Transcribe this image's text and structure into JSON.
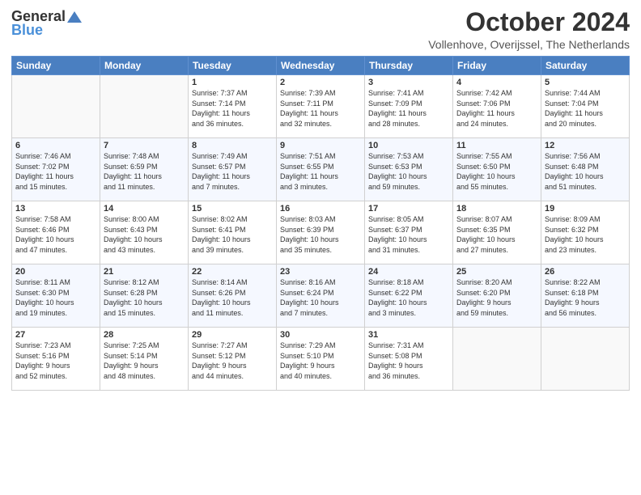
{
  "logo": {
    "general": "General",
    "blue": "Blue"
  },
  "title": "October 2024",
  "location": "Vollenhove, Overijssel, The Netherlands",
  "days_header": [
    "Sunday",
    "Monday",
    "Tuesday",
    "Wednesday",
    "Thursday",
    "Friday",
    "Saturday"
  ],
  "weeks": [
    [
      {
        "day": "",
        "info": ""
      },
      {
        "day": "",
        "info": ""
      },
      {
        "day": "1",
        "info": "Sunrise: 7:37 AM\nSunset: 7:14 PM\nDaylight: 11 hours\nand 36 minutes."
      },
      {
        "day": "2",
        "info": "Sunrise: 7:39 AM\nSunset: 7:11 PM\nDaylight: 11 hours\nand 32 minutes."
      },
      {
        "day": "3",
        "info": "Sunrise: 7:41 AM\nSunset: 7:09 PM\nDaylight: 11 hours\nand 28 minutes."
      },
      {
        "day": "4",
        "info": "Sunrise: 7:42 AM\nSunset: 7:06 PM\nDaylight: 11 hours\nand 24 minutes."
      },
      {
        "day": "5",
        "info": "Sunrise: 7:44 AM\nSunset: 7:04 PM\nDaylight: 11 hours\nand 20 minutes."
      }
    ],
    [
      {
        "day": "6",
        "info": "Sunrise: 7:46 AM\nSunset: 7:02 PM\nDaylight: 11 hours\nand 15 minutes."
      },
      {
        "day": "7",
        "info": "Sunrise: 7:48 AM\nSunset: 6:59 PM\nDaylight: 11 hours\nand 11 minutes."
      },
      {
        "day": "8",
        "info": "Sunrise: 7:49 AM\nSunset: 6:57 PM\nDaylight: 11 hours\nand 7 minutes."
      },
      {
        "day": "9",
        "info": "Sunrise: 7:51 AM\nSunset: 6:55 PM\nDaylight: 11 hours\nand 3 minutes."
      },
      {
        "day": "10",
        "info": "Sunrise: 7:53 AM\nSunset: 6:53 PM\nDaylight: 10 hours\nand 59 minutes."
      },
      {
        "day": "11",
        "info": "Sunrise: 7:55 AM\nSunset: 6:50 PM\nDaylight: 10 hours\nand 55 minutes."
      },
      {
        "day": "12",
        "info": "Sunrise: 7:56 AM\nSunset: 6:48 PM\nDaylight: 10 hours\nand 51 minutes."
      }
    ],
    [
      {
        "day": "13",
        "info": "Sunrise: 7:58 AM\nSunset: 6:46 PM\nDaylight: 10 hours\nand 47 minutes."
      },
      {
        "day": "14",
        "info": "Sunrise: 8:00 AM\nSunset: 6:43 PM\nDaylight: 10 hours\nand 43 minutes."
      },
      {
        "day": "15",
        "info": "Sunrise: 8:02 AM\nSunset: 6:41 PM\nDaylight: 10 hours\nand 39 minutes."
      },
      {
        "day": "16",
        "info": "Sunrise: 8:03 AM\nSunset: 6:39 PM\nDaylight: 10 hours\nand 35 minutes."
      },
      {
        "day": "17",
        "info": "Sunrise: 8:05 AM\nSunset: 6:37 PM\nDaylight: 10 hours\nand 31 minutes."
      },
      {
        "day": "18",
        "info": "Sunrise: 8:07 AM\nSunset: 6:35 PM\nDaylight: 10 hours\nand 27 minutes."
      },
      {
        "day": "19",
        "info": "Sunrise: 8:09 AM\nSunset: 6:32 PM\nDaylight: 10 hours\nand 23 minutes."
      }
    ],
    [
      {
        "day": "20",
        "info": "Sunrise: 8:11 AM\nSunset: 6:30 PM\nDaylight: 10 hours\nand 19 minutes."
      },
      {
        "day": "21",
        "info": "Sunrise: 8:12 AM\nSunset: 6:28 PM\nDaylight: 10 hours\nand 15 minutes."
      },
      {
        "day": "22",
        "info": "Sunrise: 8:14 AM\nSunset: 6:26 PM\nDaylight: 10 hours\nand 11 minutes."
      },
      {
        "day": "23",
        "info": "Sunrise: 8:16 AM\nSunset: 6:24 PM\nDaylight: 10 hours\nand 7 minutes."
      },
      {
        "day": "24",
        "info": "Sunrise: 8:18 AM\nSunset: 6:22 PM\nDaylight: 10 hours\nand 3 minutes."
      },
      {
        "day": "25",
        "info": "Sunrise: 8:20 AM\nSunset: 6:20 PM\nDaylight: 9 hours\nand 59 minutes."
      },
      {
        "day": "26",
        "info": "Sunrise: 8:22 AM\nSunset: 6:18 PM\nDaylight: 9 hours\nand 56 minutes."
      }
    ],
    [
      {
        "day": "27",
        "info": "Sunrise: 7:23 AM\nSunset: 5:16 PM\nDaylight: 9 hours\nand 52 minutes."
      },
      {
        "day": "28",
        "info": "Sunrise: 7:25 AM\nSunset: 5:14 PM\nDaylight: 9 hours\nand 48 minutes."
      },
      {
        "day": "29",
        "info": "Sunrise: 7:27 AM\nSunset: 5:12 PM\nDaylight: 9 hours\nand 44 minutes."
      },
      {
        "day": "30",
        "info": "Sunrise: 7:29 AM\nSunset: 5:10 PM\nDaylight: 9 hours\nand 40 minutes."
      },
      {
        "day": "31",
        "info": "Sunrise: 7:31 AM\nSunset: 5:08 PM\nDaylight: 9 hours\nand 36 minutes."
      },
      {
        "day": "",
        "info": ""
      },
      {
        "day": "",
        "info": ""
      }
    ]
  ]
}
